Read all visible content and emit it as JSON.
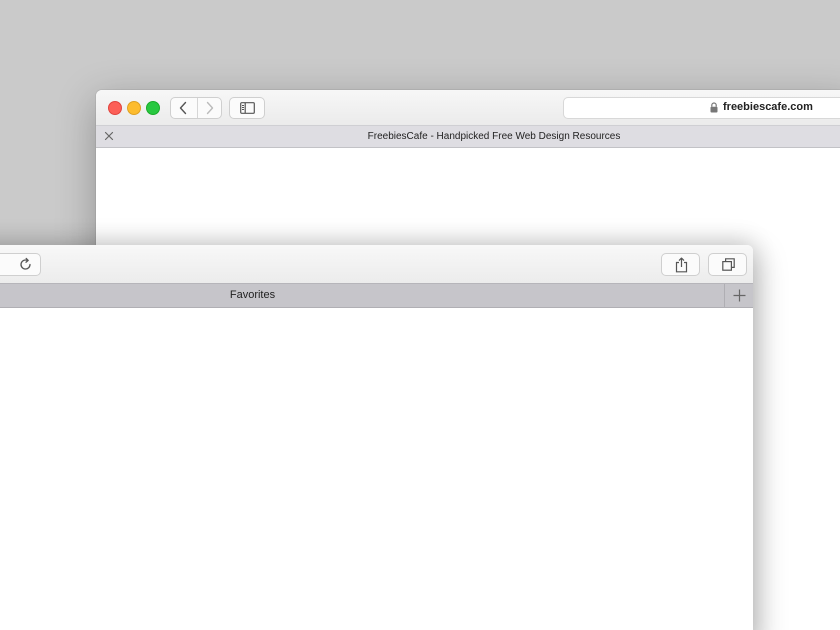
{
  "back_window": {
    "url": "freebiescafe.com",
    "tab": {
      "title": "FreebiesCafe - Handpicked Free Web Design Resources"
    },
    "icons": {
      "lock": "lock-icon",
      "back": "chevron-left-icon",
      "forward": "chevron-right-icon",
      "sidebar": "sidebar-icon",
      "close": "close-icon"
    },
    "traffic_lights": {
      "close": "#fc5f57",
      "minimize": "#fdbc2e",
      "zoom": "#28c840"
    }
  },
  "front_window": {
    "tab": {
      "title": "Favorites"
    },
    "icons": {
      "reload": "reload-icon",
      "share": "share-icon",
      "tabs": "tab-overview-icon",
      "new_tab": "plus-icon"
    }
  },
  "colors": {
    "desktop": "#cacaca",
    "toolbar": "#efefef",
    "active_tabbar": "#c6c5ca",
    "inactive_tabbar": "#dedde2"
  }
}
